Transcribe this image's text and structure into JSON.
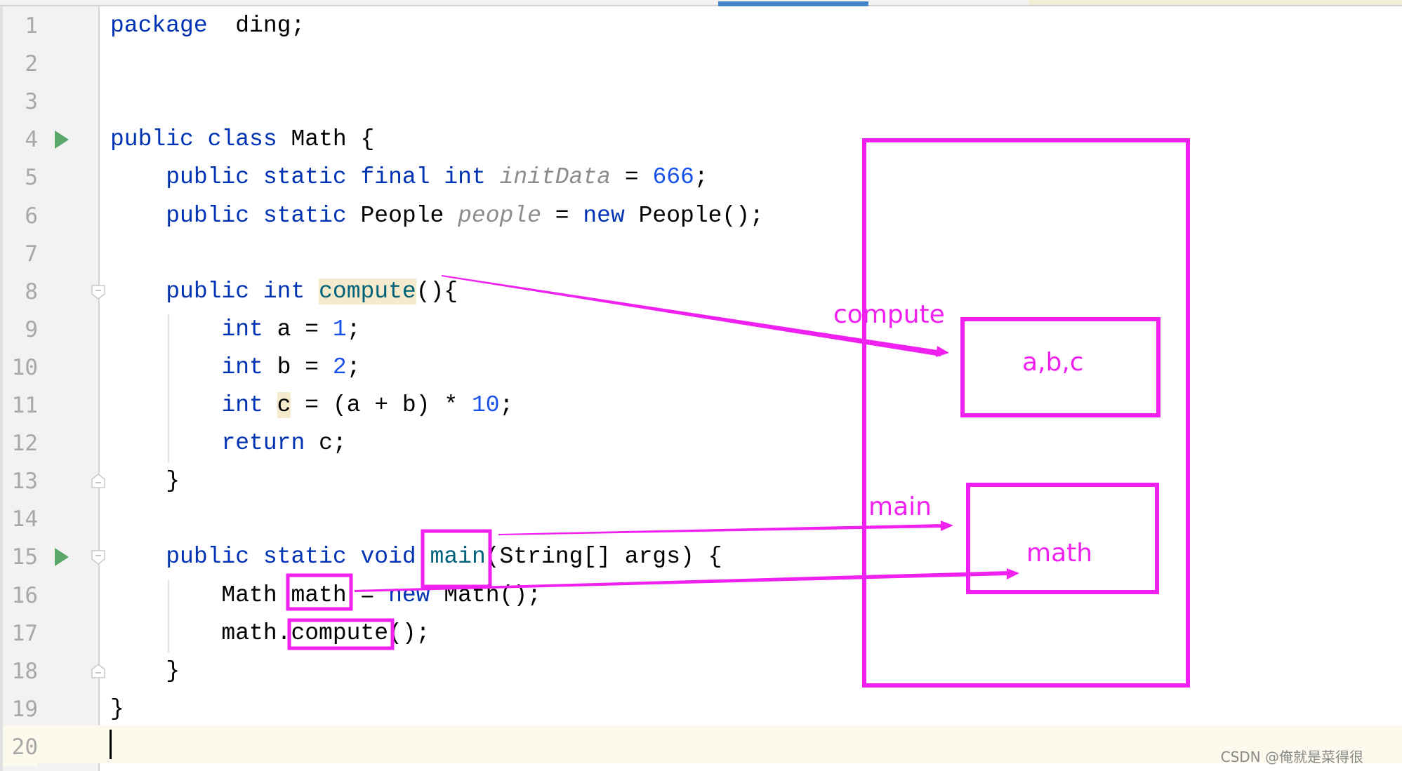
{
  "editor": {
    "language": "Java",
    "current_line": 20,
    "line_numbers": [
      "1",
      "2",
      "3",
      "4",
      "5",
      "6",
      "7",
      "8",
      "9",
      "10",
      "11",
      "12",
      "13",
      "14",
      "15",
      "16",
      "17",
      "18",
      "19",
      "20"
    ],
    "run_markers": [
      4,
      15
    ],
    "fold_markers": [
      8,
      13,
      15,
      18
    ],
    "lines": [
      {
        "n": 1,
        "tokens": [
          [
            "kw",
            "package"
          ],
          [
            "",
            "  ding;"
          ]
        ]
      },
      {
        "n": 2,
        "tokens": []
      },
      {
        "n": 3,
        "tokens": []
      },
      {
        "n": 4,
        "tokens": [
          [
            "kw",
            "public"
          ],
          [
            "",
            " "
          ],
          [
            "kw",
            "class"
          ],
          [
            "",
            " Math {"
          ]
        ]
      },
      {
        "n": 5,
        "tokens": [
          [
            "",
            "    "
          ],
          [
            "kw",
            "public"
          ],
          [
            "",
            " "
          ],
          [
            "kw",
            "static"
          ],
          [
            "",
            " "
          ],
          [
            "kw",
            "final"
          ],
          [
            "",
            " "
          ],
          [
            "kw",
            "int"
          ],
          [
            "",
            " "
          ],
          [
            "fld",
            "initData"
          ],
          [
            "",
            " = "
          ],
          [
            "num",
            "666"
          ],
          [
            "",
            ";"
          ]
        ]
      },
      {
        "n": 6,
        "tokens": [
          [
            "",
            "    "
          ],
          [
            "kw",
            "public"
          ],
          [
            "",
            " "
          ],
          [
            "kw",
            "static"
          ],
          [
            "",
            " People "
          ],
          [
            "fld",
            "people"
          ],
          [
            "",
            " = "
          ],
          [
            "kw",
            "new"
          ],
          [
            "",
            " People();"
          ]
        ]
      },
      {
        "n": 7,
        "tokens": []
      },
      {
        "n": 8,
        "tokens": [
          [
            "",
            "    "
          ],
          [
            "kw",
            "public"
          ],
          [
            "",
            " "
          ],
          [
            "kw",
            "int"
          ],
          [
            "",
            " "
          ],
          [
            "fn hl",
            "compute"
          ],
          [
            "",
            "(){"
          ]
        ]
      },
      {
        "n": 9,
        "tokens": [
          [
            "",
            "        "
          ],
          [
            "kw",
            "int"
          ],
          [
            "",
            " a = "
          ],
          [
            "num",
            "1"
          ],
          [
            "",
            ";"
          ]
        ]
      },
      {
        "n": 10,
        "tokens": [
          [
            "",
            "        "
          ],
          [
            "kw",
            "int"
          ],
          [
            "",
            " b = "
          ],
          [
            "num",
            "2"
          ],
          [
            "",
            ";"
          ]
        ]
      },
      {
        "n": 11,
        "tokens": [
          [
            "",
            "        "
          ],
          [
            "kw",
            "int"
          ],
          [
            "",
            " "
          ],
          [
            "hl",
            "c"
          ],
          [
            "",
            " = (a + b) * "
          ],
          [
            "num",
            "10"
          ],
          [
            "",
            ";"
          ]
        ]
      },
      {
        "n": 12,
        "tokens": [
          [
            "",
            "        "
          ],
          [
            "kw",
            "return"
          ],
          [
            "",
            " c;"
          ]
        ]
      },
      {
        "n": 13,
        "tokens": [
          [
            "",
            "    }"
          ]
        ]
      },
      {
        "n": 14,
        "tokens": []
      },
      {
        "n": 15,
        "tokens": [
          [
            "",
            "    "
          ],
          [
            "kw",
            "public"
          ],
          [
            "",
            " "
          ],
          [
            "kw",
            "static"
          ],
          [
            "",
            " "
          ],
          [
            "kw",
            "void"
          ],
          [
            "",
            " "
          ],
          [
            "fn",
            "main"
          ],
          [
            "",
            "(String[] args) {"
          ]
        ]
      },
      {
        "n": 16,
        "tokens": [
          [
            "",
            "        Math math = "
          ],
          [
            "kw",
            "new"
          ],
          [
            "",
            " Math();"
          ]
        ]
      },
      {
        "n": 17,
        "tokens": [
          [
            "",
            "        math.compute();"
          ]
        ]
      },
      {
        "n": 18,
        "tokens": [
          [
            "",
            "    }"
          ]
        ]
      },
      {
        "n": 19,
        "tokens": [
          [
            "",
            "}"
          ]
        ]
      },
      {
        "n": 20,
        "tokens": []
      }
    ]
  },
  "annotations": {
    "color": "#f020f0",
    "stack_labels": {
      "compute_frame": "compute",
      "main_frame": "main"
    },
    "frame_contents": {
      "compute_frame": "a,b,c",
      "main_frame": "math"
    },
    "highlighted_tokens": [
      "main",
      "math",
      "compute"
    ]
  },
  "watermark": "CSDN @俺就是菜得很"
}
